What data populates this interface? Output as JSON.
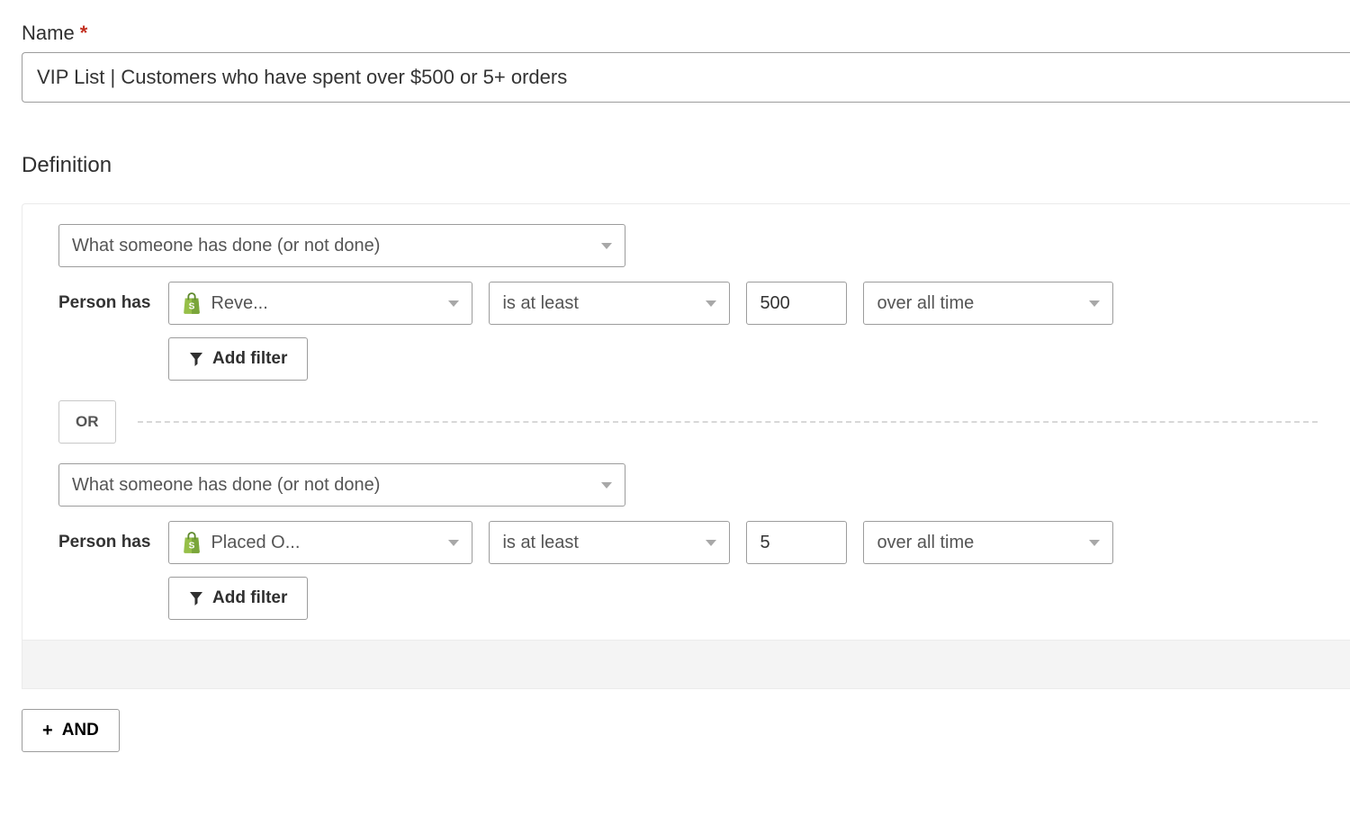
{
  "name_field": {
    "label": "Name",
    "required_marker": "*",
    "value": "VIP List | Customers who have spent over $500 or 5+ orders"
  },
  "definition": {
    "heading": "Definition",
    "groups": [
      {
        "condition_type": "What someone has done (or not done)",
        "prefix_label": "Person has",
        "metric": "Reve...",
        "operator": "is at least",
        "value": "500",
        "timeframe": "over all time",
        "add_filter_label": "Add filter"
      },
      {
        "condition_type": "What someone has done (or not done)",
        "prefix_label": "Person has",
        "metric": "Placed O...",
        "operator": "is at least",
        "value": "5",
        "timeframe": "over all time",
        "add_filter_label": "Add filter"
      }
    ],
    "or_label": "OR",
    "and_label": "AND",
    "plus_glyph": "+"
  },
  "icons": {
    "shopify": "shopify-bag-icon",
    "funnel": "filter-icon",
    "caret": "chevron-down-icon"
  }
}
